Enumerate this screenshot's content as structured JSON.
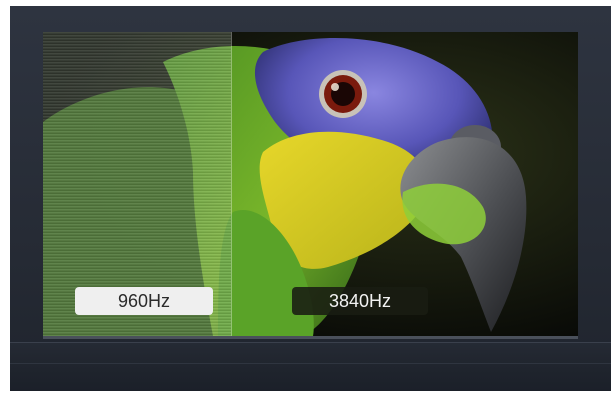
{
  "labels": {
    "left": "960Hz",
    "right": "3840Hz"
  },
  "colors": {
    "frame": "#2a2f39",
    "left_label_bg": "#efefef",
    "right_label_bg": "#1b1e14"
  }
}
